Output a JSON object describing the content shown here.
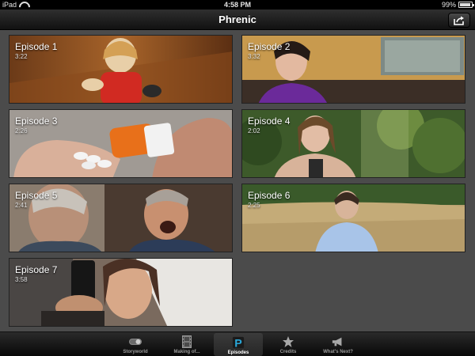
{
  "status_bar": {
    "device": "iPad",
    "time": "4:58 PM",
    "battery": "99%"
  },
  "nav_bar": {
    "title": "Phrenic",
    "share_icon": "share-icon"
  },
  "episodes": [
    {
      "title": "Episode 1",
      "duration": "3:22"
    },
    {
      "title": "Episode 2",
      "duration": "3:32"
    },
    {
      "title": "Episode 3",
      "duration": "2:26"
    },
    {
      "title": "Episode 4",
      "duration": "2:02"
    },
    {
      "title": "Episode 5",
      "duration": "2:41"
    },
    {
      "title": "Episode 6",
      "duration": "2:25"
    },
    {
      "title": "Episode 7",
      "duration": "3:58"
    }
  ],
  "tabs": [
    {
      "label": "Storyworld",
      "icon": "toggle-icon",
      "active": false
    },
    {
      "label": "Making of...",
      "icon": "film-icon",
      "active": false
    },
    {
      "label": "Episodes",
      "icon": "p-logo-icon",
      "active": true
    },
    {
      "label": "Credits",
      "icon": "star-icon",
      "active": false
    },
    {
      "label": "What's Next?",
      "icon": "megaphone-icon",
      "active": false
    }
  ],
  "colors": {
    "background": "#4b4b4b",
    "accent": "#2aa7d8"
  }
}
